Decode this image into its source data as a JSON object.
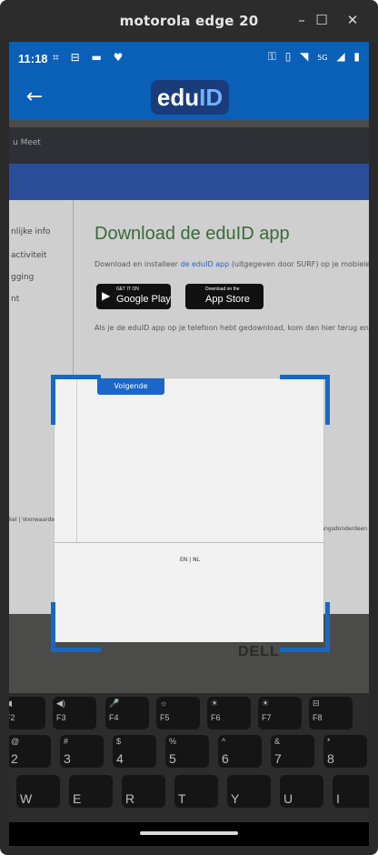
{
  "window": {
    "title": "motorola edge 20",
    "buttons": [
      "–",
      "☐",
      "✕"
    ]
  },
  "status": {
    "time": "11:18",
    "left_icons": [
      "⌗",
      "⊟",
      "▬",
      "♥"
    ],
    "right_icons": [
      "⚿",
      "▯",
      "◥",
      "5G",
      "◢",
      "▮"
    ]
  },
  "appbar": {
    "back_icon": "←",
    "logo_edu": "edu",
    "logo_id": "ID"
  },
  "camera": {
    "browser_tab": "u Meet",
    "sidebar": [
      "nlijke info",
      "activiteit",
      "gging",
      "nt"
    ],
    "heading": "Download de eduID app",
    "subtext_before": "Download en installeer ",
    "subtext_link": "de eduID app",
    "subtext_after": " (uitgegeven door SURF) op je mobiele apparaa",
    "google": {
      "small": "GET IT ON",
      "big": "Google Play",
      "icon": "▶"
    },
    "apple": {
      "small": "Download on the",
      "big": "App Store",
      "icon": ""
    },
    "after_text": "Als je de eduID app op je telefoon hebt gedownload, kom dan hier terug en klik op vo",
    "volgende": "Volgende",
    "lang": "EN | NL",
    "footer_left": "kel | Voorwaarden",
    "footer_right": "Rangsdonderdeen",
    "dell": "DELL"
  },
  "keys": {
    "frow": [
      {
        "top": "◀",
        "bottom": "F2"
      },
      {
        "top": "◀)",
        "bottom": "F3"
      },
      {
        "top": "🎤",
        "bottom": "F4"
      },
      {
        "top": "☼",
        "bottom": "F5"
      },
      {
        "top": "☀",
        "bottom": "F6"
      },
      {
        "top": "☀",
        "bottom": "F7"
      },
      {
        "top": "⊟",
        "bottom": "F8"
      }
    ],
    "numrow": [
      {
        "top": "@",
        "bottom": "2"
      },
      {
        "top": "#",
        "bottom": "3"
      },
      {
        "top": "$",
        "bottom": "4"
      },
      {
        "top": "%",
        "bottom": "5"
      },
      {
        "top": "^",
        "bottom": "6"
      },
      {
        "top": "&",
        "bottom": "7"
      },
      {
        "top": "*",
        "bottom": "8"
      }
    ],
    "letters": [
      "W",
      "E",
      "R",
      "T",
      "Y",
      "U",
      "I"
    ]
  }
}
